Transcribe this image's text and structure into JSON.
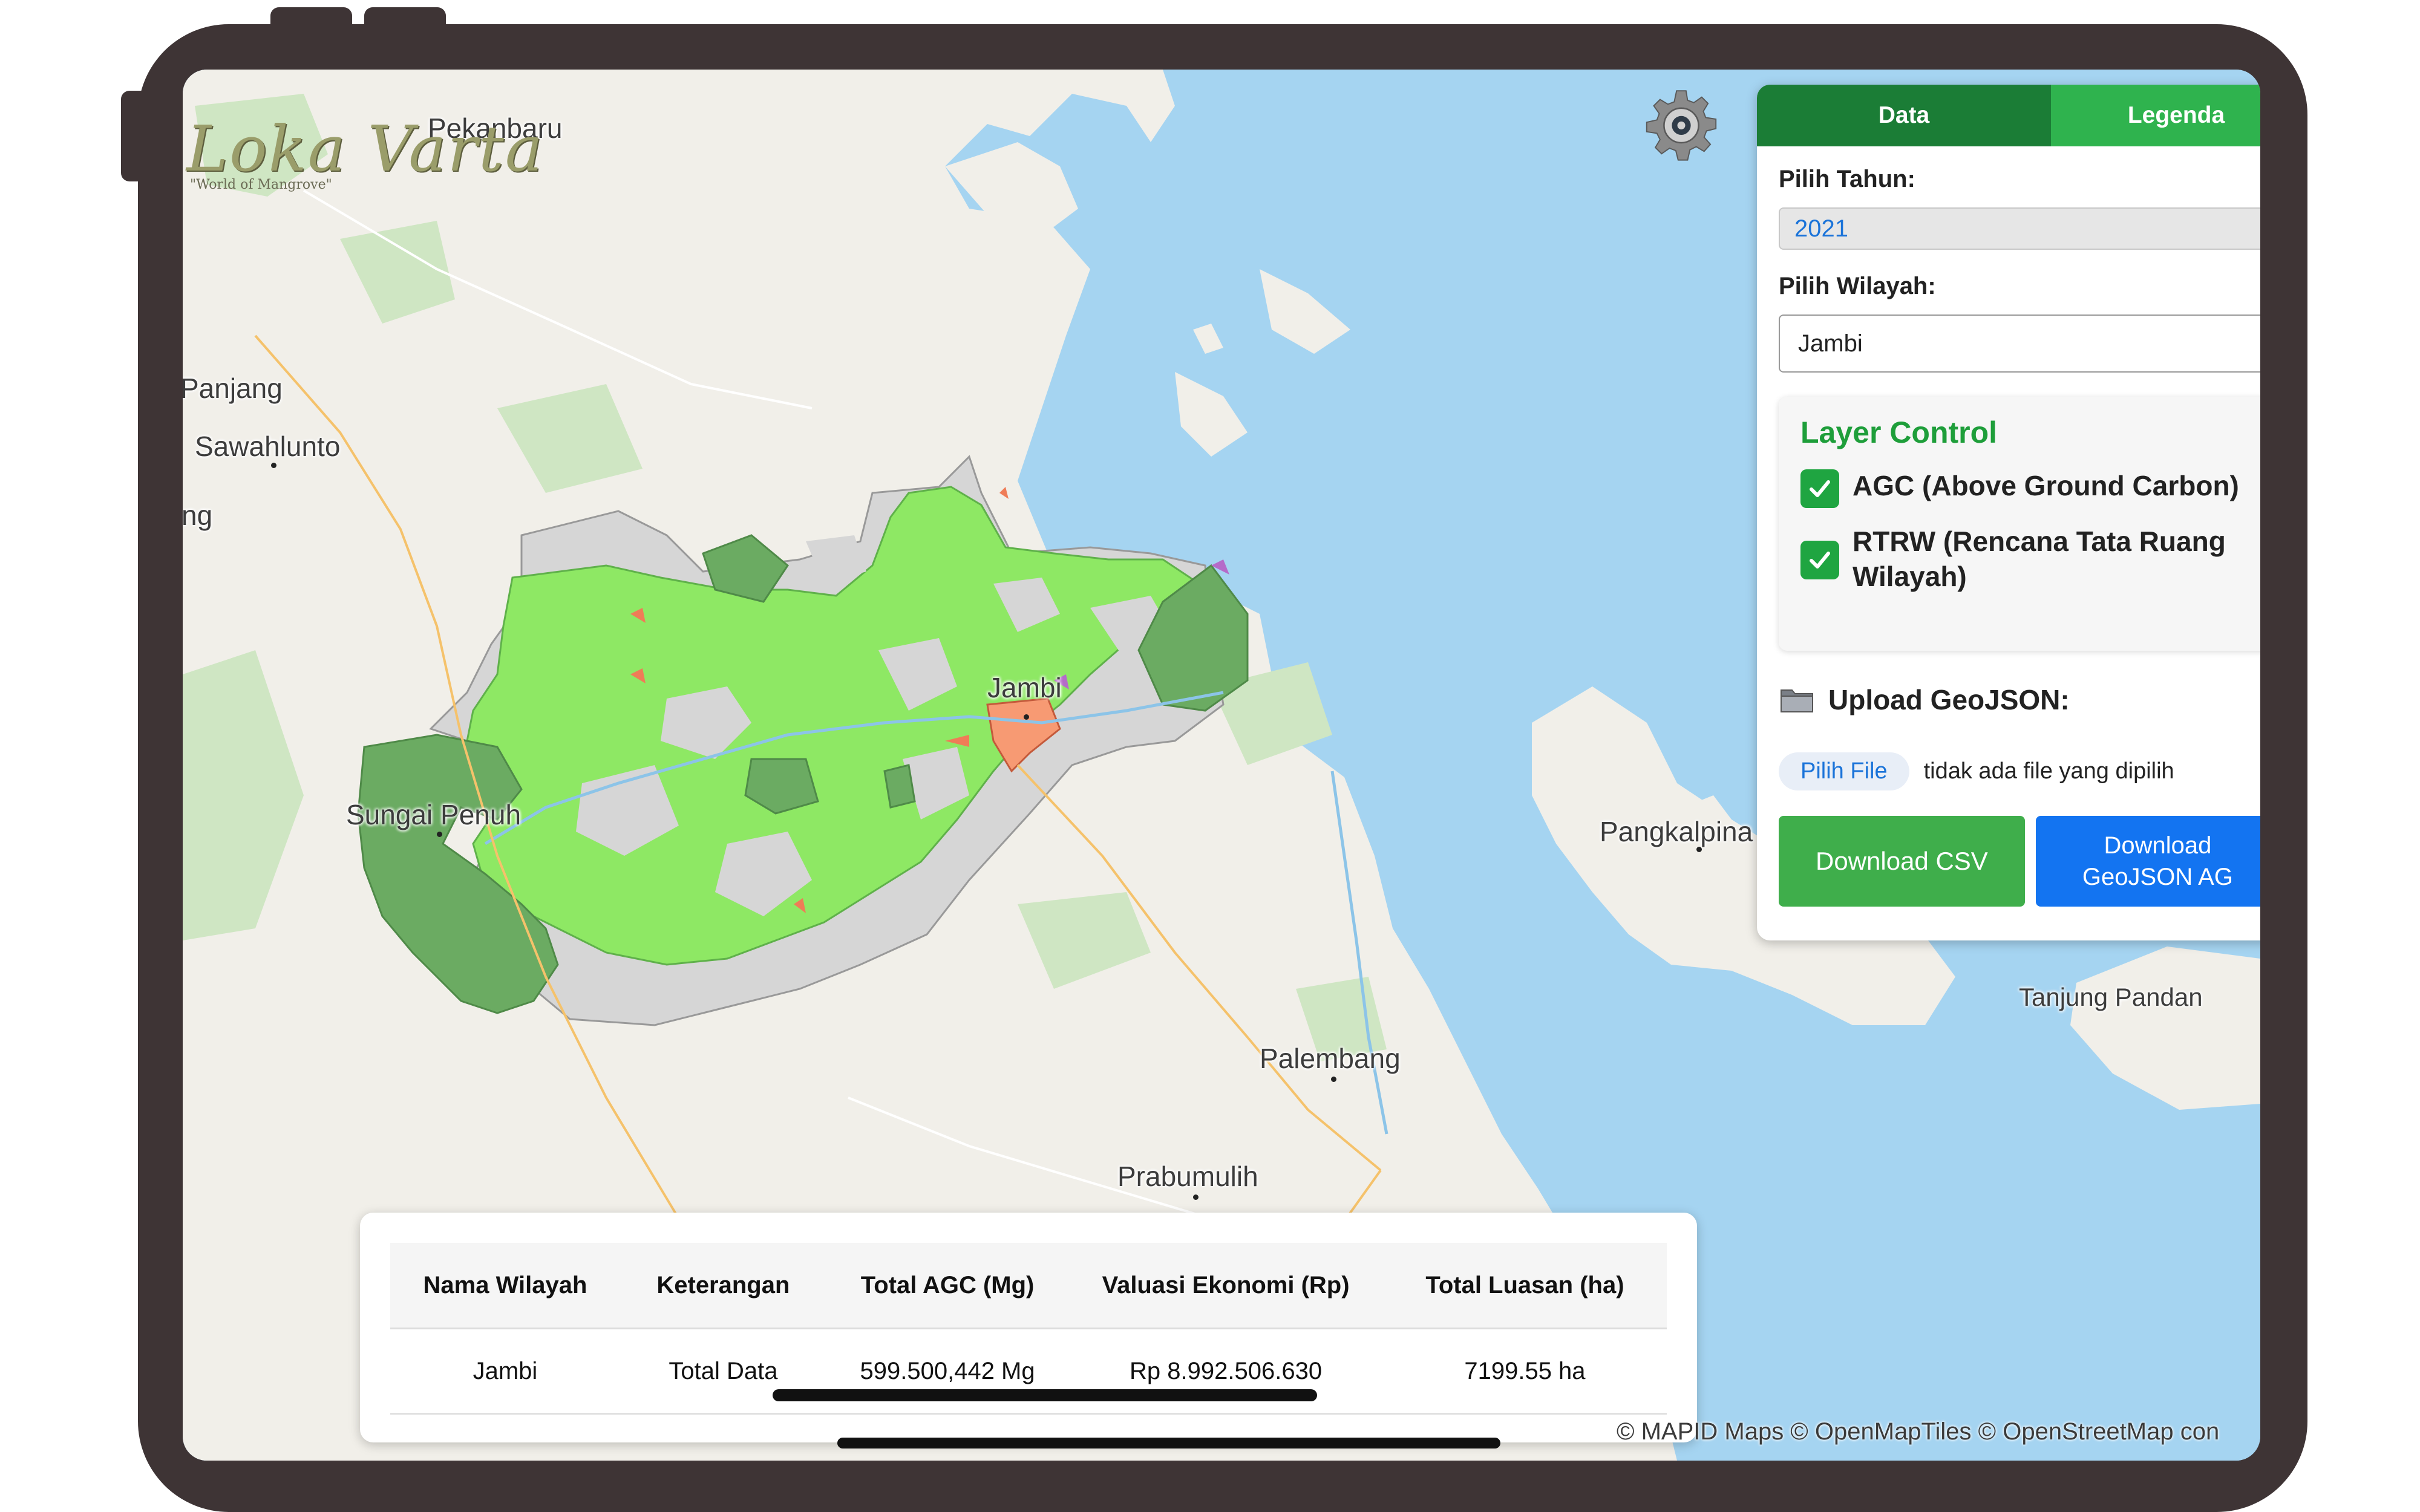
{
  "logo": {
    "name": "Loka Varta",
    "tagline": "\"World of Mangrove\""
  },
  "map": {
    "labels": {
      "pekanbaru": "Pekanbaru",
      "panjang": "Panjang",
      "sawahlunto": "Sawahlunto",
      "ng": "ng",
      "jambi": "Jambi",
      "sungai_penuh": "Sungai Penuh",
      "pangkalpinang": "Pangkalpina",
      "tanjung_pandan": "Tanjung Pandan",
      "palembang": "Palembang",
      "prabumulih": "Prabumulih"
    },
    "attribution": "© MAPID Maps © OpenMapTiles © OpenStreetMap con",
    "colors": {
      "water": "#a5d4f1",
      "land": "#f1efe9",
      "agc_bright": "#8ee864",
      "agc_dark": "#6bab62",
      "unclassified": "#d8d8d8",
      "urban": "#f79a73"
    }
  },
  "settings": {
    "icon": "gear-icon"
  },
  "panel": {
    "tabs": {
      "data": "Data",
      "legend": "Legenda"
    },
    "year_label": "Pilih Tahun:",
    "year_value": "2021",
    "region_label": "Pilih Wilayah:",
    "region_value": "Jambi",
    "layer_control": {
      "title": "Layer Control",
      "agc": "AGC (Above Ground Carbon)",
      "rtrw_line1": "RTRW (Rencana Tata Ruang",
      "rtrw_line2": "Wilayah)"
    },
    "upload": {
      "title": "Upload GeoJSON:",
      "choose_file": "Pilih File",
      "file_status": "tidak ada file yang dipilih"
    },
    "buttons": {
      "download_csv": "Download CSV",
      "download_geojson": "Download\nGeoJSON AG"
    },
    "colors": {
      "tab_active": "#1b7d36",
      "tab_inactive": "#2fb34e",
      "csv": "#3fae4b",
      "geojson": "#1374f1"
    }
  },
  "table": {
    "headers": [
      "Nama Wilayah",
      "Keterangan",
      "Total AGC (Mg)",
      "Valuasi Ekonomi (Rp)",
      "Total Luasan (ha)"
    ],
    "rows": [
      [
        "Jambi",
        "Total Data",
        "599.500,442 Mg",
        "Rp 8.992.506.630",
        "7199.55 ha"
      ]
    ]
  }
}
